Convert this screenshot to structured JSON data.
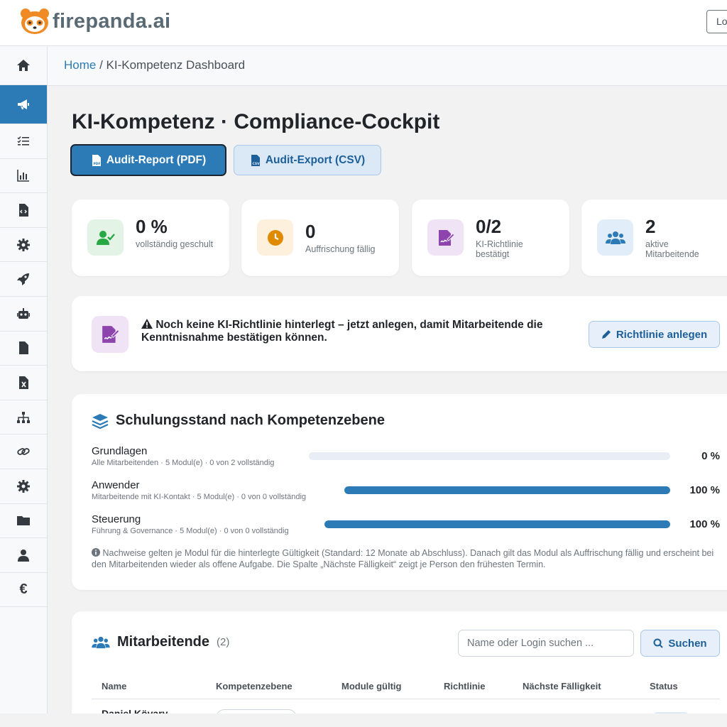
{
  "brand": {
    "name": "firepanda.ai",
    "login_label": "Lo"
  },
  "breadcrumb": {
    "home": "Home",
    "separator": " / ",
    "current": "KI-Kompetenz Dashboard"
  },
  "page": {
    "title": "KI-Kompetenz · Compliance-Cockpit"
  },
  "actions": {
    "pdf_label": "Audit-Report (PDF)",
    "csv_label": "Audit-Export (CSV)"
  },
  "kpis": [
    {
      "value": "0 %",
      "label": "vollständig geschult",
      "color": "#28a745"
    },
    {
      "value": "0",
      "label": "Auffrischung fällig",
      "color": "#e08a00"
    },
    {
      "value": "0/2",
      "label": "KI-Richtlinie bestätigt",
      "color": "#8e44ad"
    },
    {
      "value": "2",
      "label": "aktive Mitarbeitende",
      "color": "#2c7bb6"
    }
  ],
  "alert": {
    "text": "Noch keine KI-Richtlinie hinterlegt – jetzt anlegen, damit Mitarbeitende die Kenntnisnahme bestätigen können.",
    "button_label": "Richtlinie anlegen"
  },
  "training": {
    "title": "Schulungsstand nach Kompetenzebene",
    "levels": [
      {
        "name": "Grundlagen",
        "sub": "Alle Mitarbeitenden · 5 Modul(e) · 0 von 2 vollständig",
        "percent": 0,
        "percent_label": "0 %"
      },
      {
        "name": "Anwender",
        "sub": "Mitarbeitende mit KI-Kontakt · 5 Modul(e) · 0 von 0 vollständig",
        "percent": 100,
        "percent_label": "100 %"
      },
      {
        "name": "Steuerung",
        "sub": "Führung & Governance · 5 Modul(e) · 0 von 0 vollständig",
        "percent": 100,
        "percent_label": "100 %"
      }
    ],
    "note": "Nachweise gelten je Modul für die hinterlegte Gültigkeit (Standard: 12 Monate ab Abschluss). Danach gilt das Modul als Auffrischung fällig und erscheint bei den Mitarbeitenden wieder als offene Aufgabe. Die Spalte „Nächste Fälligkeit“ zeigt je Person den frühesten Termin."
  },
  "staff": {
    "title": "Mitarbeitende",
    "count": "(2)",
    "search_placeholder": "Name oder Login suchen ...",
    "search_label": "Suchen",
    "columns": [
      "Name",
      "Kompetenzebene",
      "Module gültig",
      "Richtlinie",
      "Nächste Fälligkeit",
      "Status"
    ],
    "rows": [
      {
        "name": "Daniel Kövary"
      }
    ]
  },
  "sidebar_icons": [
    "home-icon",
    "megaphone-icon",
    "checklist-icon",
    "bar-chart-icon",
    "code-file-icon",
    "gear-icon",
    "rocket-icon",
    "robot-icon",
    "file-icon",
    "excel-file-icon",
    "sitemap-icon",
    "link-icon",
    "gear-icon",
    "folder-icon",
    "user-icon",
    "euro-icon"
  ]
}
